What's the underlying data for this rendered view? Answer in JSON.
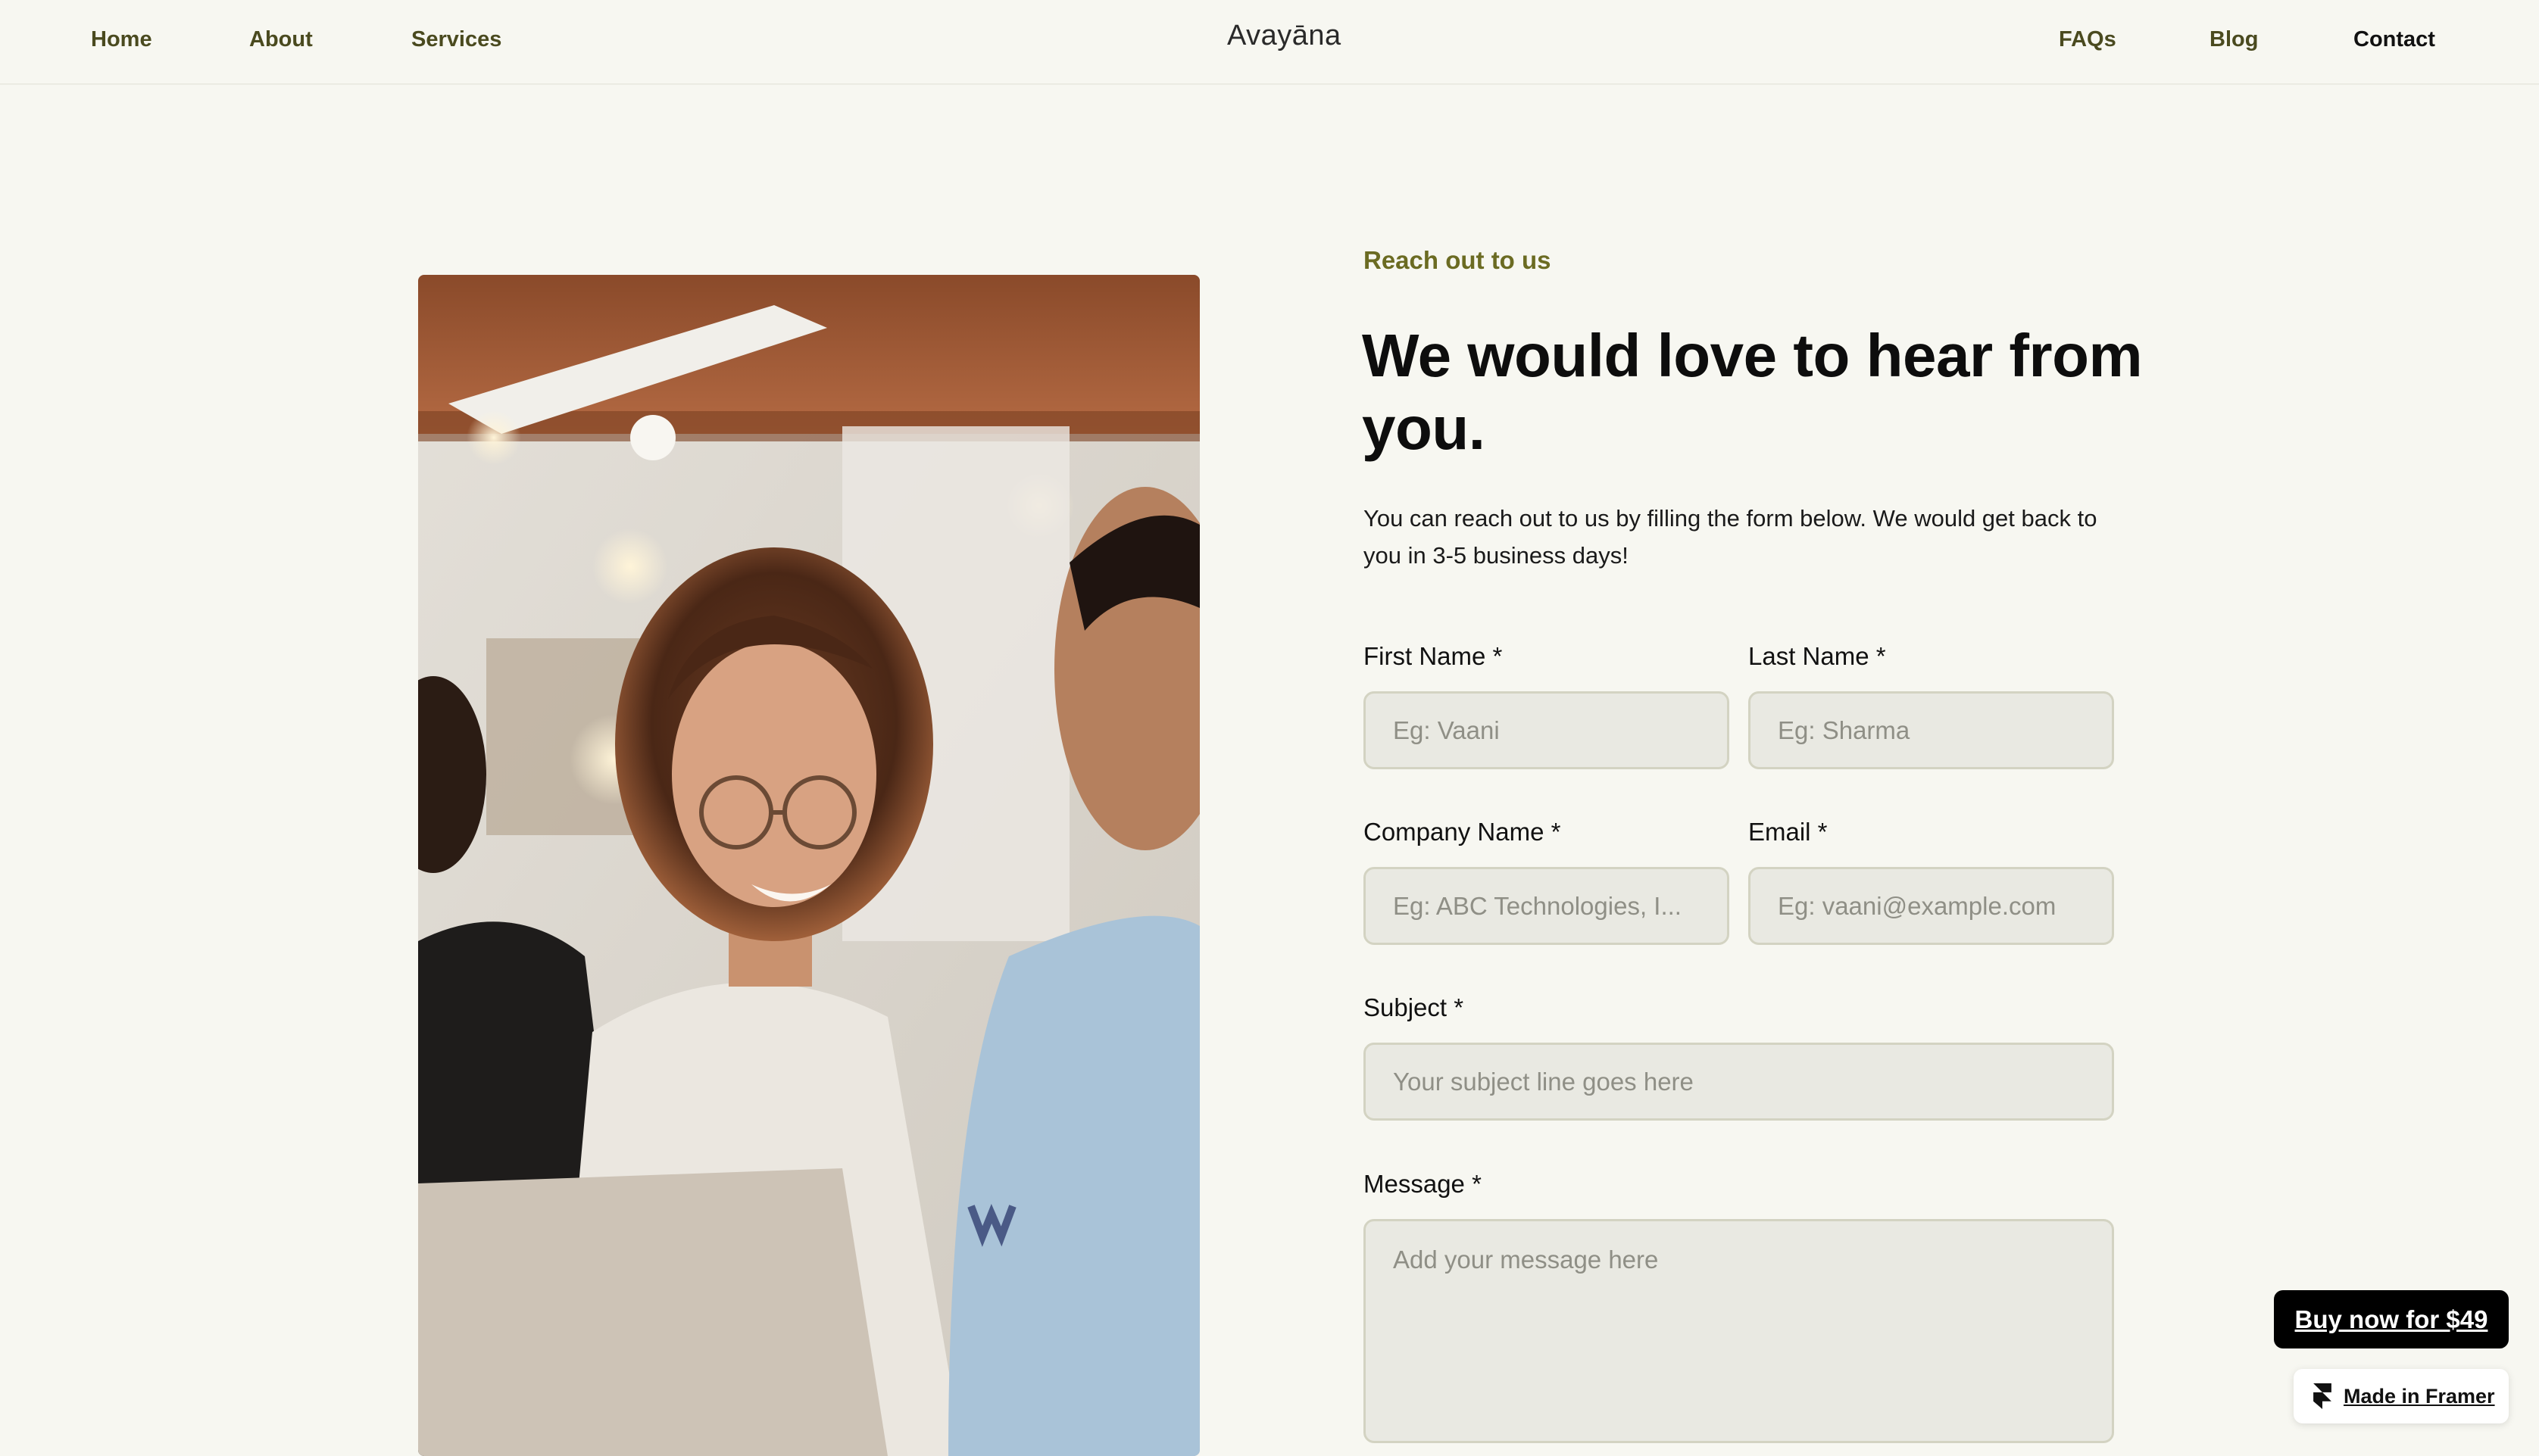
{
  "nav": {
    "left_links": [
      {
        "label": "Home"
      },
      {
        "label": "About"
      },
      {
        "label": "Services"
      }
    ],
    "brand": "Avayāna",
    "right_links": [
      {
        "label": "FAQs"
      },
      {
        "label": "Blog"
      },
      {
        "label": "Contact",
        "active": true
      }
    ]
  },
  "hero_image": {
    "subject": "people-working-photo"
  },
  "contact": {
    "eyebrow": "Reach out to us",
    "headline": "We would love to hear from you.",
    "intro": "You can reach out to us by filling the form below. We would get back to you in 3-5 business days!",
    "form": {
      "first_name": {
        "label": "First Name *",
        "placeholder": "Eg: Vaani"
      },
      "last_name": {
        "label": "Last Name *",
        "placeholder": "Eg: Sharma"
      },
      "company": {
        "label": "Company Name *",
        "placeholder": "Eg: ABC Technologies, I..."
      },
      "email": {
        "label": "Email *",
        "placeholder": "Eg: vaani@example.com"
      },
      "subject": {
        "label": "Subject *",
        "placeholder": "Your subject line goes here"
      },
      "message": {
        "label": "Message *",
        "placeholder": "Add your message here"
      }
    }
  },
  "badges": {
    "buy_label": "Buy now for $49",
    "framer_label": "Made in Framer"
  },
  "colors": {
    "background": "#f7f7f1",
    "nav_link": "#4a4a1f",
    "eyebrow": "#6b6b22",
    "field_bg": "#e9e9e2",
    "field_border": "#d3d3c2",
    "button_bg": "#000000"
  }
}
